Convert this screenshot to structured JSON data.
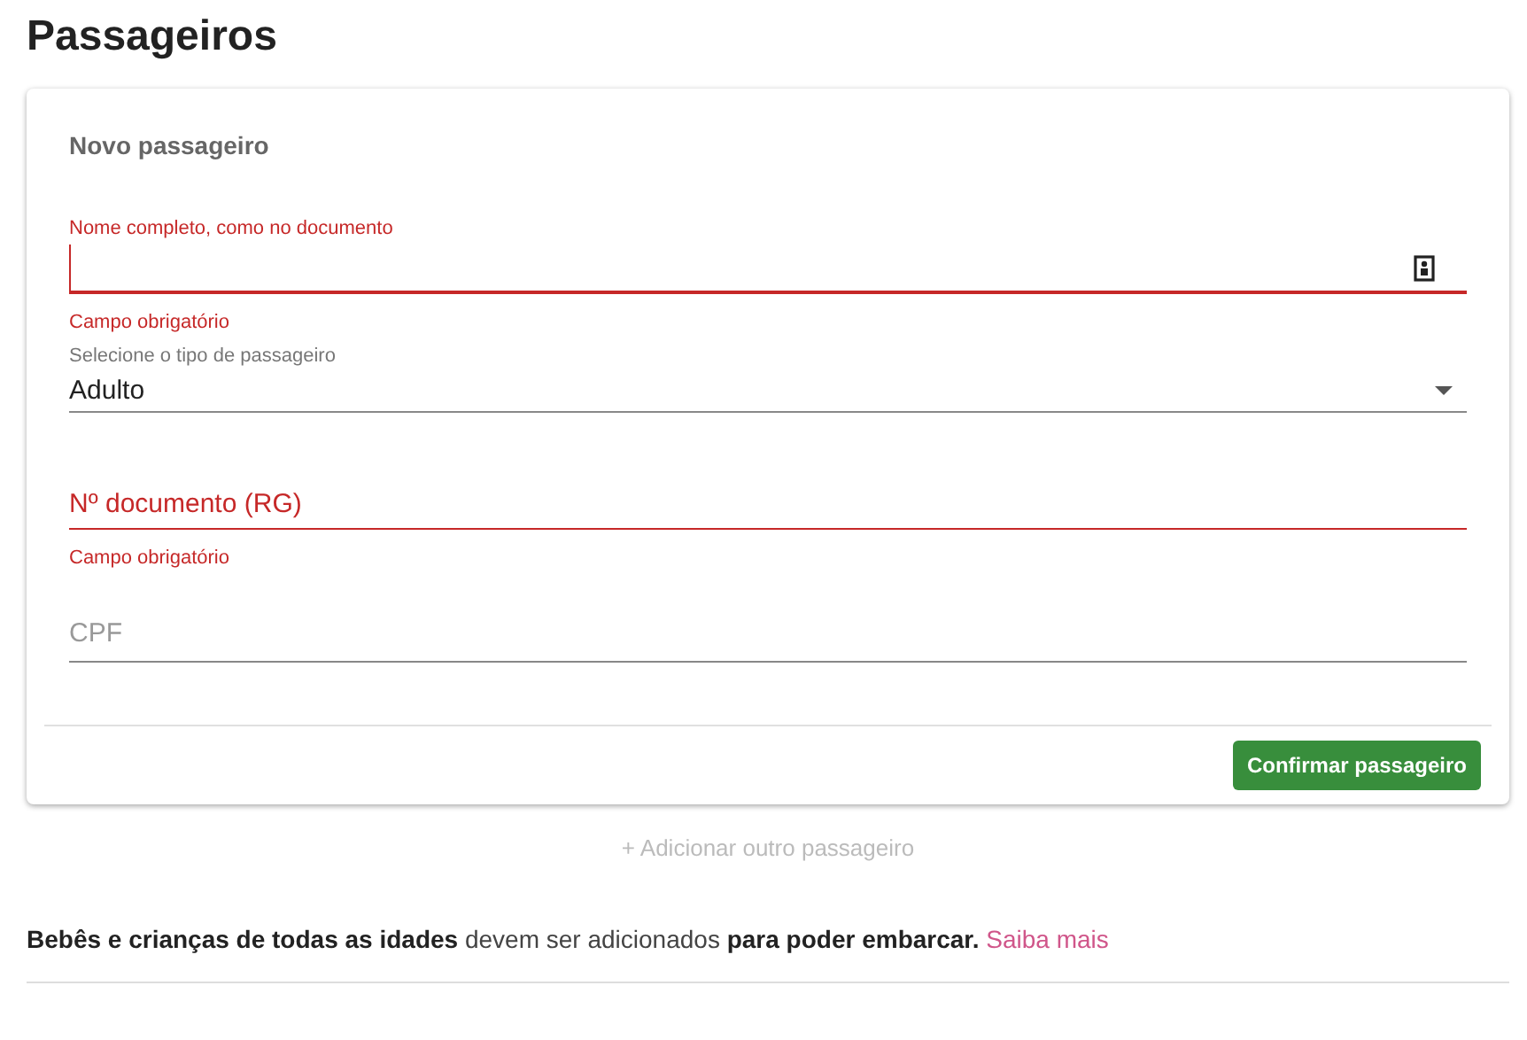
{
  "title": "Passageiros",
  "card": {
    "heading": "Novo passageiro",
    "fields": [
      {
        "kind": "text",
        "label": "Nome completo, como no documento",
        "focused": true,
        "error": "Campo obrigatório",
        "icon": true
      },
      {
        "kind": "select",
        "label": "Selecione o tipo de passageiro",
        "value": "Adulto"
      },
      {
        "kind": "text",
        "placeholder": "Nº documento (RG)",
        "focused": false,
        "error": "Campo obrigatório"
      },
      {
        "kind": "text",
        "placeholder": "CPF",
        "focused": false
      }
    ],
    "confirm_button": "Confirmar passageiro"
  },
  "add_link": "+ Adicionar outro passageiro",
  "notice": {
    "text": "**Bebês e crianças de todas as idades** devem ser adicionados **para poder embarcar.**",
    "link": "Saiba mais"
  }
}
